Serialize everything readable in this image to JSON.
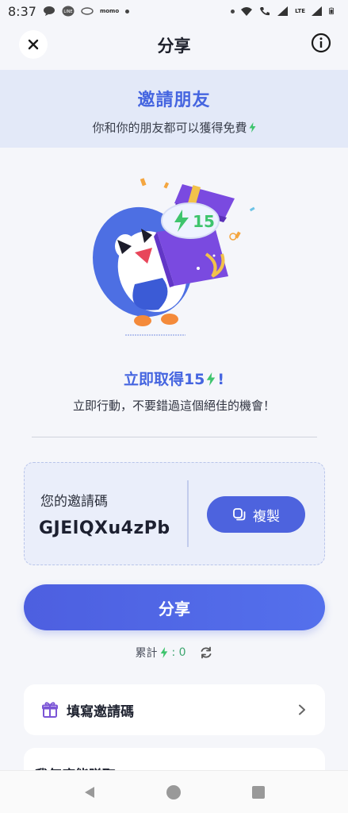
{
  "status_bar": {
    "time": "8:37",
    "app_labels": [
      "LINE",
      "momo"
    ],
    "network": "LTE"
  },
  "header": {
    "title": "分享"
  },
  "banner": {
    "title": "邀請朋友",
    "subtitle": "你和你的朋友都可以獲得免費"
  },
  "illustration": {
    "badge_number": "15"
  },
  "offer": {
    "title": "立即取得15",
    "title_suffix": "!",
    "subtitle": "立即行動，不要錯過這個絕佳的機會！"
  },
  "invite_code": {
    "label": "您的邀請碼",
    "value": "GJElQXu4zPb",
    "copy_label": "複製"
  },
  "share_button": {
    "label": "分享"
  },
  "total": {
    "label": "累計",
    "value": ": 0"
  },
  "list": {
    "enter_code_label": "填寫邀請碼",
    "next_item_partial": "我每座能賺取"
  },
  "colors": {
    "accent": "#4d63de",
    "title_blue": "#4565e0",
    "bolt_green": "#3ec46d",
    "banner_bg": "#e3e9f8",
    "gift_purple": "#7b55d6"
  },
  "icons": [
    "close-icon",
    "info-icon",
    "lightning-icon",
    "copy-icon",
    "refresh-icon",
    "gift-icon",
    "chevron-right-icon",
    "back-icon",
    "home-icon",
    "recents-icon"
  ]
}
